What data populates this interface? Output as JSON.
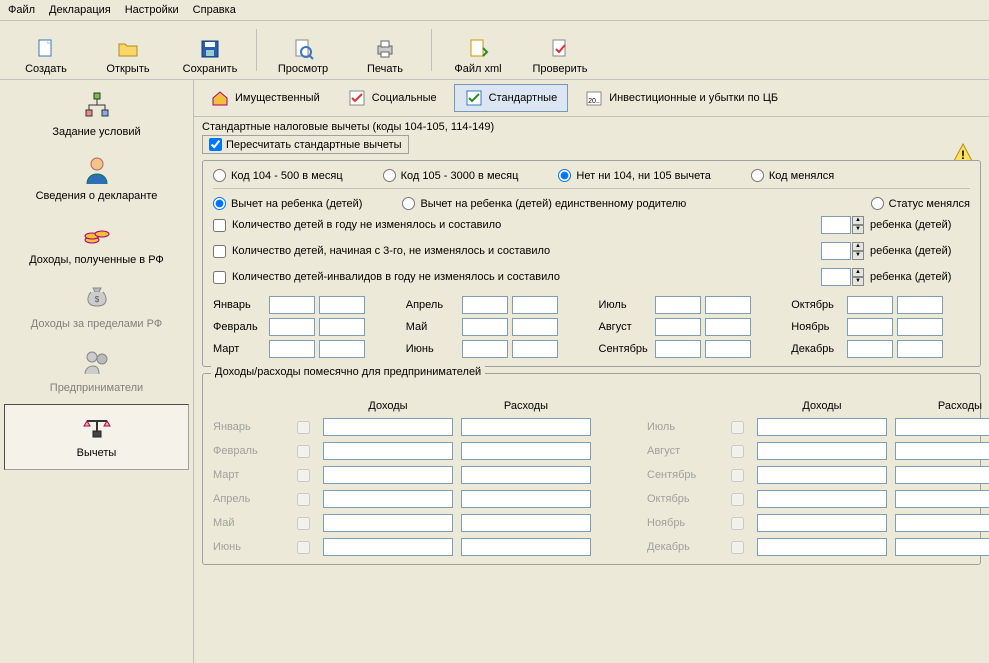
{
  "menu": {
    "file": "Файл",
    "decl": "Декларация",
    "settings": "Настройки",
    "help": "Справка"
  },
  "toolbar": {
    "create": "Создать",
    "open": "Открыть",
    "save": "Сохранить",
    "preview": "Просмотр",
    "print": "Печать",
    "xml": "Файл xml",
    "check": "Проверить"
  },
  "sidebar": {
    "conditions": "Задание условий",
    "declarant": "Сведения о декларанте",
    "income_rf": "Доходы, полученные в РФ",
    "income_foreign": "Доходы за пределами РФ",
    "entrepreneur": "Предприниматели",
    "deductions": "Вычеты"
  },
  "subtabs": {
    "property": "Имущественный",
    "social": "Социальные",
    "standard": "Стандартные",
    "invest": "Инвестиционные и убытки по ЦБ"
  },
  "content": {
    "group_title": "Стандартные налоговые вычеты (коды 104-105, 114-149)",
    "recalc": "Пересчитать стандартные вычеты",
    "r1_a": "Код 104 - 500 в месяц",
    "r1_b": "Код 105 - 3000 в месяц",
    "r1_c": "Нет ни 104, ни 105 вычета",
    "r1_d": "Код менялся",
    "r2_a": "Вычет на ребенка (детей)",
    "r2_b": "Вычет на ребенка (детей) единственному родителю",
    "r2_c": "Статус менялся",
    "chk1": "Количество детей в году не изменялось и составило",
    "chk2": "Количество детей, начиная с 3-го, не изменялось и составило",
    "chk3": "Количество детей-инвалидов в году не изменялось и составило",
    "child_suffix": "ребенка (детей)",
    "months": [
      "Январь",
      "Февраль",
      "Март",
      "Апрель",
      "Май",
      "Июнь",
      "Июль",
      "Август",
      "Сентябрь",
      "Октябрь",
      "Ноябрь",
      "Декабрь"
    ],
    "entrepreneur_title": "Доходы/расходы помесячно для предпринимателей",
    "income_hdr": "Доходы",
    "expense_hdr": "Расходы"
  }
}
